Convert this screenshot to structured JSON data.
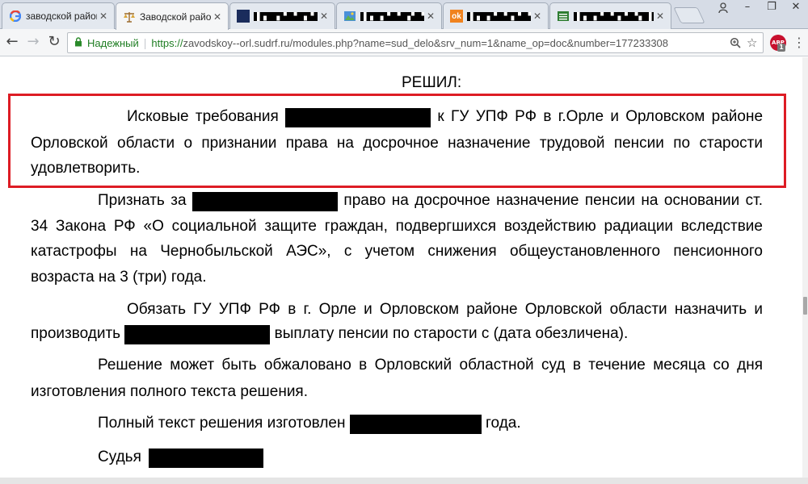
{
  "tabs": [
    {
      "title": "заводской район",
      "icon": "google-icon",
      "active": false
    },
    {
      "title": "Заводской район",
      "icon": "scales-icon",
      "active": true
    },
    {
      "title": "▌▖ ▗ ▘▝ ▗ ▘▝▖▌",
      "icon": "blank-icon",
      "active": false
    },
    {
      "title": "▌▖▗ ▘▝ ▗▘▝ ▖▌",
      "icon": "photo-icon",
      "active": false
    },
    {
      "title": "▌▖▗ ▘▝▗ ▘▝▖",
      "icon": "ok-icon",
      "active": false
    },
    {
      "title": "▌▖▗ ▘▝▗ ▘▝▖ ▌",
      "icon": "sheet-icon",
      "active": false
    }
  ],
  "toolbar": {
    "secure_label": "Надежный",
    "url_scheme": "https://",
    "url_rest": "zavodskoy--orl.sudrf.ru/modules.php?name=sud_delo&srv_num=1&name_op=doc&number=177233308",
    "adblock_label": "ABP",
    "adblock_count": "1"
  },
  "document": {
    "top_cut_text": "▔ ▔▔▔ ▔ ▔▔ ▔ ▔▔ ▔▔ ▔▔▔ ▔▔",
    "heading": "РЕШИЛ:",
    "para1": {
      "l1a": "Исковые требования",
      "l1b": "к ГУ УПФ РФ в г.Орле и Орловском районе",
      "l2": "Орловской области о признании права на досрочное назначение трудовой пенсии по старости",
      "l3": "удовлетворить."
    },
    "para2": {
      "l1a": "Признать за",
      "l1b": "право на досрочное назначение пенсии на основании ст.",
      "l2": "34 Закона РФ «О социальной защите граждан, подвергшихся воздействию радиации вследствие",
      "l3": "катастрофы на Чернобыльской АЭС», с учетом снижения общеустановленного пенсионного",
      "l4": "возраста на 3 (три) года."
    },
    "para3": {
      "l1": "Обязать ГУ УПФ РФ в г. Орле и Орловском районе Орловской области назначить и",
      "l2a": "производить",
      "l2b": "выплату пенсии по старости с (дата обезличена)."
    },
    "para4": {
      "l1": "Решение может быть обжаловано в Орловский областной суд в течение месяца со дня",
      "l2": "изготовления полного текста решения."
    },
    "para5": {
      "a": "Полный текст решения изготовлен",
      "b": "года."
    },
    "judge": "Судья"
  }
}
